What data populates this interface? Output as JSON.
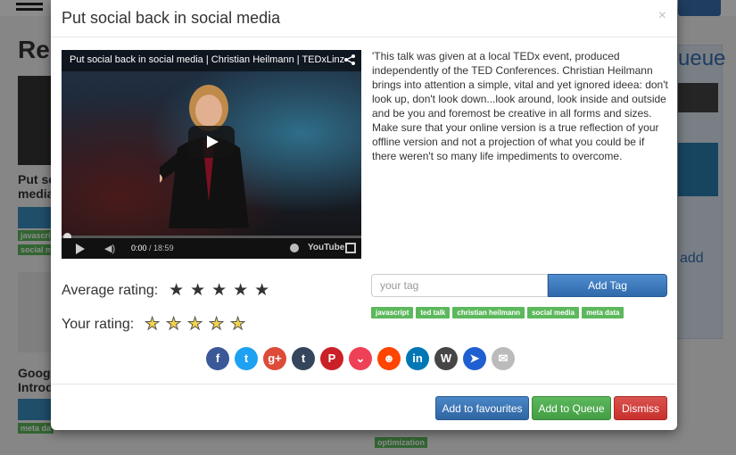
{
  "modal": {
    "title": "Put social back in social media",
    "close_glyph": "×"
  },
  "video": {
    "title": "Put social back in social media | Christian Heilmann | TEDxLinz",
    "current_time": "0:00",
    "duration": "/ 18:59",
    "progress_fraction": 0.0,
    "youtube_label": "YouTube"
  },
  "description": "'This talk was given at a local TEDx event, produced independently of the TED Conferences. Christian Heilmann brings into attention a simple, vital and yet ignored ideea: don't look up, don't look down...look around, look inside and outside and be you and foremost be creative in all forms and sizes. Make sure that your online version is a true reflection of your offline version and not a projection of what you could be if there weren't so many life impediments to overcome.",
  "ratings": {
    "average_label": "Average rating:",
    "average_value": 5,
    "your_label": "Your rating:",
    "your_value": 0,
    "max": 5
  },
  "tagging": {
    "input_placeholder": "your tag",
    "input_value": "",
    "add_button": "Add Tag",
    "tags": [
      "javascript",
      "ted talk",
      "christian heilmann",
      "social media",
      "meta data"
    ]
  },
  "share_icons": [
    {
      "name": "facebook-icon",
      "glyph": "f",
      "color": "#3b5998"
    },
    {
      "name": "twitter-icon",
      "glyph": "t",
      "color": "#1da1f2"
    },
    {
      "name": "google-plus-icon",
      "glyph": "g+",
      "color": "#dd4b39"
    },
    {
      "name": "tumblr-icon",
      "glyph": "t",
      "color": "#35465c"
    },
    {
      "name": "pinterest-icon",
      "glyph": "P",
      "color": "#cb2027"
    },
    {
      "name": "pocket-icon",
      "glyph": "⌄",
      "color": "#ee4056"
    },
    {
      "name": "reddit-icon",
      "glyph": "☻",
      "color": "#ff4500"
    },
    {
      "name": "linkedin-icon",
      "glyph": "in",
      "color": "#0077b5"
    },
    {
      "name": "wordpress-icon",
      "glyph": "W",
      "color": "#464646"
    },
    {
      "name": "pinboard-icon",
      "glyph": "➤",
      "color": "#1f5fd1"
    },
    {
      "name": "email-icon",
      "glyph": "✉",
      "color": "#bbbbbb"
    }
  ],
  "footer": {
    "favourites_button": "Add to favourites",
    "queue_button": "Add to Queue",
    "dismiss_button": "Dismiss"
  },
  "background": {
    "heading": "Re",
    "queue_heading": "ueue",
    "card1_title_line1": "Put so",
    "card1_title_line2": "media",
    "card2_title_line1": "Googl",
    "card2_title_line2": "Introd",
    "queue_link": "add",
    "bg_tags": [
      "javascript",
      "social m",
      "meta da",
      "optimization"
    ]
  }
}
